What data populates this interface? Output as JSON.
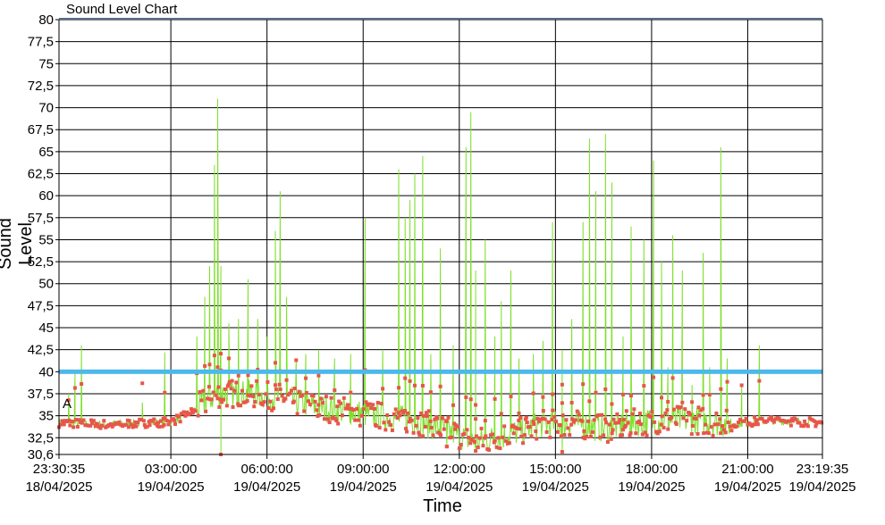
{
  "chart_data": {
    "type": "line",
    "title": "Sound Level Chart",
    "xlabel": "Time",
    "ylabel": "Sound Level",
    "ylim": [
      30.6,
      80
    ],
    "y_ticks": [
      "80",
      "77,5",
      "75",
      "72,5",
      "70",
      "67,5",
      "65",
      "62,5",
      "60",
      "57,5",
      "55",
      "52,5",
      "50",
      "47,5",
      "45",
      "42,5",
      "40",
      "37,5",
      "35",
      "32,5",
      "30,6"
    ],
    "x_start": "18/04/2025 23:30:35",
    "x_end": "19/04/2025 23:19:35",
    "x_ticks": [
      {
        "time": "23:30:35",
        "date": "18/04/2025",
        "hours": 0
      },
      {
        "time": "03:00:00",
        "date": "19/04/2025",
        "hours": 3.49
      },
      {
        "time": "06:00:00",
        "date": "19/04/2025",
        "hours": 6.49
      },
      {
        "time": "09:00:00",
        "date": "19/04/2025",
        "hours": 9.49
      },
      {
        "time": "12:00:00",
        "date": "19/04/2025",
        "hours": 12.49
      },
      {
        "time": "15:00:00",
        "date": "19/04/2025",
        "hours": 15.49
      },
      {
        "time": "18:00:00",
        "date": "19/04/2025",
        "hours": 18.49
      },
      {
        "time": "21:00:00",
        "date": "19/04/2025",
        "hours": 21.49
      },
      {
        "time": "23:19:35",
        "date": "19/04/2025",
        "hours": 23.82
      }
    ],
    "threshold": {
      "value": 40,
      "color": "#4db8ea"
    },
    "annotation": "A",
    "annotation_level": 35.4,
    "series": [
      {
        "color": "#7ee02a",
        "marker_color": "#e8564a",
        "baseline": [
          [
            0,
            34.2
          ],
          [
            1.5,
            34.0
          ],
          [
            3.5,
            34.3
          ],
          [
            4.2,
            35.5
          ],
          [
            4.5,
            36.5
          ],
          [
            5.0,
            37.5
          ],
          [
            6.0,
            37.5
          ],
          [
            7.0,
            37.0
          ],
          [
            8.0,
            36.0
          ],
          [
            9.0,
            35.5
          ],
          [
            10.0,
            35.0
          ],
          [
            11.0,
            34.5
          ],
          [
            12.0,
            33.5
          ],
          [
            13.0,
            32.0
          ],
          [
            14.0,
            32.8
          ],
          [
            15.0,
            34.0
          ],
          [
            16.0,
            34.2
          ],
          [
            17.0,
            33.5
          ],
          [
            18.0,
            34.2
          ],
          [
            19.0,
            34.5
          ],
          [
            20.0,
            34.5
          ],
          [
            21.0,
            34.0
          ],
          [
            22.0,
            34.5
          ],
          [
            23.82,
            34.2
          ]
        ],
        "peaks": [
          [
            0.3,
            37.5
          ],
          [
            0.5,
            40.0
          ],
          [
            0.7,
            43.0
          ],
          [
            2.6,
            36.5
          ],
          [
            3.3,
            42.2
          ],
          [
            4.3,
            44.0
          ],
          [
            4.55,
            48.5
          ],
          [
            4.7,
            52.0
          ],
          [
            4.85,
            63.5
          ],
          [
            4.95,
            71.0
          ],
          [
            5.05,
            52.0
          ],
          [
            5.3,
            45.5
          ],
          [
            5.6,
            46.0
          ],
          [
            5.9,
            50.5
          ],
          [
            6.2,
            46.0
          ],
          [
            6.5,
            44.0
          ],
          [
            6.75,
            56.0
          ],
          [
            6.9,
            60.5
          ],
          [
            7.1,
            48.5
          ],
          [
            7.4,
            41.5
          ],
          [
            7.7,
            42.0
          ],
          [
            8.1,
            42.5
          ],
          [
            8.6,
            41.5
          ],
          [
            9.1,
            42.0
          ],
          [
            9.55,
            57.5
          ],
          [
            10.1,
            42.5
          ],
          [
            10.6,
            63.0
          ],
          [
            10.8,
            57.5
          ],
          [
            10.95,
            59.5
          ],
          [
            11.1,
            62.5
          ],
          [
            11.35,
            64.5
          ],
          [
            11.6,
            42.0
          ],
          [
            11.9,
            54.0
          ],
          [
            12.3,
            43.0
          ],
          [
            12.7,
            65.5
          ],
          [
            12.85,
            69.5
          ],
          [
            13.0,
            51.5
          ],
          [
            13.3,
            55.0
          ],
          [
            13.6,
            44.0
          ],
          [
            13.8,
            48.0
          ],
          [
            14.1,
            51.5
          ],
          [
            14.35,
            41.5
          ],
          [
            14.8,
            42.0
          ],
          [
            15.1,
            43.5
          ],
          [
            15.4,
            57.0
          ],
          [
            15.7,
            42.5
          ],
          [
            16.0,
            46.0
          ],
          [
            16.35,
            57.0
          ],
          [
            16.55,
            66.5
          ],
          [
            16.75,
            60.5
          ],
          [
            17.05,
            67.0
          ],
          [
            17.25,
            61.5
          ],
          [
            17.6,
            44.0
          ],
          [
            17.85,
            56.5
          ],
          [
            18.25,
            55.0
          ],
          [
            18.55,
            64.0
          ],
          [
            18.8,
            52.5
          ],
          [
            19.0,
            40.5
          ],
          [
            19.15,
            55.5
          ],
          [
            19.45,
            51.5
          ],
          [
            19.75,
            38.5
          ],
          [
            20.1,
            53.5
          ],
          [
            20.3,
            40.5
          ],
          [
            20.65,
            65.5
          ],
          [
            20.85,
            41.5
          ],
          [
            21.3,
            38.5
          ],
          [
            21.85,
            43.0
          ]
        ],
        "dips": [
          [
            5.05,
            30.6
          ],
          [
            12.1,
            31.5
          ],
          [
            13.0,
            31.0
          ],
          [
            15.7,
            30.9
          ]
        ]
      }
    ]
  }
}
